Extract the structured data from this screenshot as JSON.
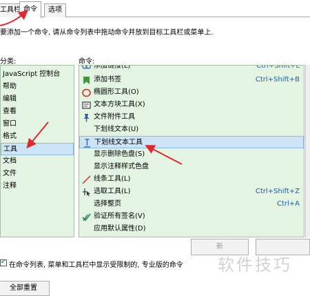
{
  "tabs": [
    {
      "label": "工具栏"
    },
    {
      "label": "命令"
    },
    {
      "label": "选项"
    }
  ],
  "description": "要添加一个命令, 请从命令列表中拖动命令并放到目标工具栏或菜单上.",
  "categories_label": "分类:",
  "commands_label": "命令:",
  "categories": [
    "JavaScript 控制台",
    "帮助",
    "编辑",
    "查看",
    "窗口",
    "格式",
    "工具",
    "文档",
    "文件",
    "注释"
  ],
  "selected_category": "工具",
  "commands": [
    {
      "name": "添加链接(L)",
      "shortcut": "Ctrl+Shift+L",
      "icon": "link-icon"
    },
    {
      "name": "添加书签",
      "shortcut": "Ctrl+Shift+B",
      "icon": "bookmark-icon"
    },
    {
      "name": "椭圆形工具(O)",
      "shortcut": "",
      "icon": "ellipse-icon"
    },
    {
      "name": "文本方块工具(X)",
      "shortcut": "",
      "icon": "textbox-icon"
    },
    {
      "name": "文件附件工具",
      "shortcut": "",
      "icon": "pin-icon"
    },
    {
      "name": "下划线文本(U)",
      "shortcut": "",
      "icon": ""
    },
    {
      "name": "下划线文本工具",
      "shortcut": "",
      "icon": "text-cursor-icon"
    },
    {
      "name": "显示删除色盘(S)",
      "shortcut": "",
      "icon": ""
    },
    {
      "name": "显示注释样式色盘",
      "shortcut": "",
      "icon": ""
    },
    {
      "name": "线条工具(L)",
      "shortcut": "",
      "icon": "line-icon"
    },
    {
      "name": "选取工具(L)",
      "shortcut": "Ctrl+Shift+Z",
      "icon": "select-icon"
    },
    {
      "name": "选择整页",
      "shortcut": "Ctrl+A",
      "icon": ""
    },
    {
      "name": "验证所有签名(V)",
      "shortcut": "",
      "icon": "verify-icon"
    },
    {
      "name": "应用默认属性(D)",
      "shortcut": "",
      "icon": ""
    }
  ],
  "selected_command": "下划线文本工具",
  "buttons": {
    "new_label": "新",
    "reset_all_label": "全部重置"
  },
  "checkbox_label": "在命令列表, 菜单和工具栏中显示受限制的, 专业版的命令",
  "checkbox_checked": true,
  "watermark": "软件技巧",
  "colors": {
    "panel_bg": "#e3f4e3",
    "selected_bg": "#cde4f7",
    "shortcut_text": "#1a5fa8",
    "annotation_arrow": "#e0282e"
  }
}
